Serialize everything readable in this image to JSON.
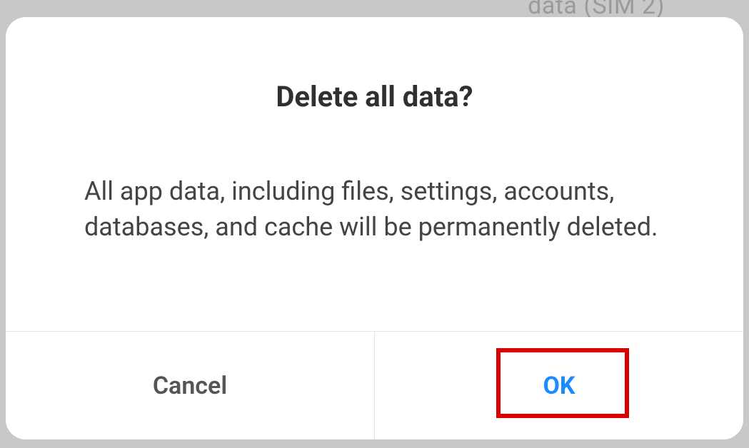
{
  "background": {
    "partial_text": "data (SIM 2)"
  },
  "dialog": {
    "title": "Delete all data?",
    "body": "All app data, including files, settings, accounts, databases, and cache will be permanently deleted.",
    "actions": {
      "cancel": "Cancel",
      "ok": "OK"
    }
  }
}
